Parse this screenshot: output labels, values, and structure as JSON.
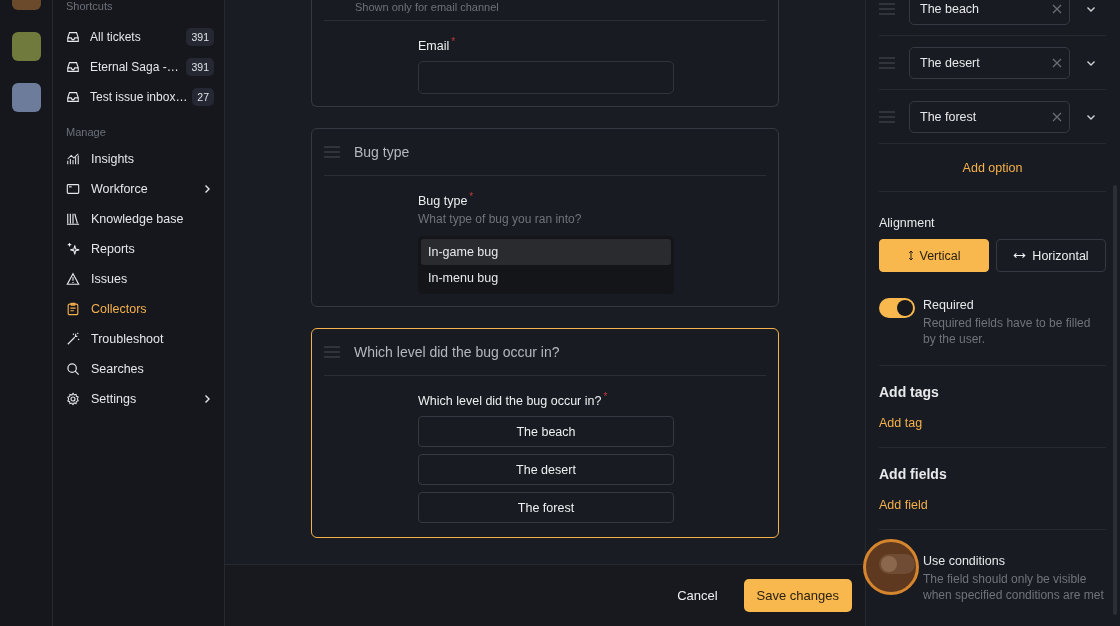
{
  "sidebar": {
    "shortcuts_heading": "Shortcuts",
    "shortcuts": [
      {
        "label": "All tickets",
        "count": "391"
      },
      {
        "label": "Eternal Saga -…",
        "count": "391"
      },
      {
        "label": "Test issue inbox…",
        "count": "27"
      }
    ],
    "manage_heading": "Manage",
    "items": [
      {
        "label": "Insights",
        "kind": "chart",
        "selected": false,
        "submenu": false
      },
      {
        "label": "Workforce",
        "kind": "window",
        "selected": false,
        "submenu": true
      },
      {
        "label": "Knowledge base",
        "kind": "books",
        "selected": false,
        "submenu": false
      },
      {
        "label": "Reports",
        "kind": "sparkle",
        "selected": false,
        "submenu": false
      },
      {
        "label": "Issues",
        "kind": "warning",
        "selected": false,
        "submenu": false
      },
      {
        "label": "Collectors",
        "kind": "clipboard",
        "selected": true,
        "submenu": false
      },
      {
        "label": "Troubleshoot",
        "kind": "wand",
        "selected": false,
        "submenu": false
      },
      {
        "label": "Searches",
        "kind": "search",
        "selected": false,
        "submenu": false
      },
      {
        "label": "Settings",
        "kind": "gear",
        "selected": false,
        "submenu": true
      }
    ]
  },
  "cards": [
    {
      "kind": "input",
      "selected": false,
      "hint": "Shown only for email channel",
      "label": "Email",
      "required_mark": "*"
    },
    {
      "kind": "list",
      "selected": false,
      "title": "Bug type",
      "label": "Bug type",
      "required_mark": "*",
      "description": "What type of bug you ran into?",
      "options": [
        {
          "label": "In-game bug",
          "selected": true
        },
        {
          "label": "In-menu bug",
          "selected": false
        }
      ]
    },
    {
      "kind": "buttons",
      "selected": true,
      "title": "Which level did the bug occur in?",
      "label": "Which level did the bug occur in?",
      "required_mark": "*",
      "options": [
        {
          "label": "The beach"
        },
        {
          "label": "The desert"
        },
        {
          "label": "The forest"
        }
      ]
    }
  ],
  "footer": {
    "cancel": "Cancel",
    "save": "Save changes"
  },
  "panel": {
    "options": [
      {
        "label": "The beach"
      },
      {
        "label": "The desert"
      },
      {
        "label": "The forest"
      }
    ],
    "add_option": "Add option",
    "alignment": {
      "label": "Alignment",
      "choices": [
        {
          "kind": "vertical",
          "label": "Vertical",
          "selected": true
        },
        {
          "kind": "horizontal",
          "label": "Horizontal",
          "selected": false
        }
      ]
    },
    "required": {
      "label": "Required",
      "description": "Required fields have to be filled by the user.",
      "on": true
    },
    "tags": {
      "heading": "Add tags",
      "link": "Add tag"
    },
    "fields": {
      "heading": "Add fields",
      "link": "Add field"
    },
    "conditions": {
      "label": "Use conditions",
      "description": "The field should only be visible when specified conditions are met",
      "on": false
    }
  }
}
